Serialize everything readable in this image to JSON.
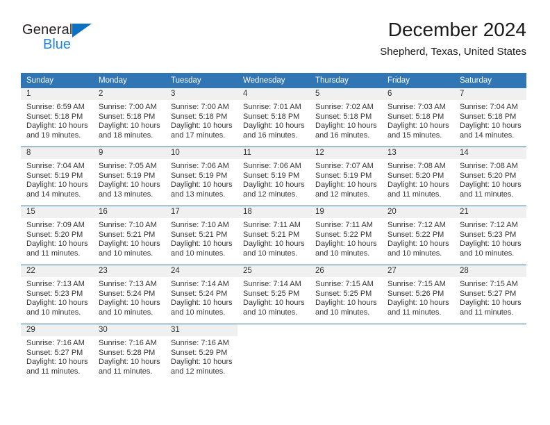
{
  "brand": {
    "name_part1": "General",
    "name_part2": "Blue",
    "triangle_icon": "triangle-icon",
    "accent_blue": "#0a71c5",
    "light_blue": "#1b87dd"
  },
  "header": {
    "title": "December 2024",
    "subtitle": "Shepherd, Texas, United States"
  },
  "theme": {
    "header_bg": "#3075b4",
    "daynum_bg": "#f0f0f0",
    "row_divider": "#3075b4",
    "text": "#333333"
  },
  "weekday_headers": [
    "Sunday",
    "Monday",
    "Tuesday",
    "Wednesday",
    "Thursday",
    "Friday",
    "Saturday"
  ],
  "weeks": [
    [
      {
        "day": "1",
        "sunrise": "Sunrise: 6:59 AM",
        "sunset": "Sunset: 5:18 PM",
        "daylight": "Daylight: 10 hours and 19 minutes."
      },
      {
        "day": "2",
        "sunrise": "Sunrise: 7:00 AM",
        "sunset": "Sunset: 5:18 PM",
        "daylight": "Daylight: 10 hours and 18 minutes."
      },
      {
        "day": "3",
        "sunrise": "Sunrise: 7:00 AM",
        "sunset": "Sunset: 5:18 PM",
        "daylight": "Daylight: 10 hours and 17 minutes."
      },
      {
        "day": "4",
        "sunrise": "Sunrise: 7:01 AM",
        "sunset": "Sunset: 5:18 PM",
        "daylight": "Daylight: 10 hours and 16 minutes."
      },
      {
        "day": "5",
        "sunrise": "Sunrise: 7:02 AM",
        "sunset": "Sunset: 5:18 PM",
        "daylight": "Daylight: 10 hours and 16 minutes."
      },
      {
        "day": "6",
        "sunrise": "Sunrise: 7:03 AM",
        "sunset": "Sunset: 5:18 PM",
        "daylight": "Daylight: 10 hours and 15 minutes."
      },
      {
        "day": "7",
        "sunrise": "Sunrise: 7:04 AM",
        "sunset": "Sunset: 5:18 PM",
        "daylight": "Daylight: 10 hours and 14 minutes."
      }
    ],
    [
      {
        "day": "8",
        "sunrise": "Sunrise: 7:04 AM",
        "sunset": "Sunset: 5:19 PM",
        "daylight": "Daylight: 10 hours and 14 minutes."
      },
      {
        "day": "9",
        "sunrise": "Sunrise: 7:05 AM",
        "sunset": "Sunset: 5:19 PM",
        "daylight": "Daylight: 10 hours and 13 minutes."
      },
      {
        "day": "10",
        "sunrise": "Sunrise: 7:06 AM",
        "sunset": "Sunset: 5:19 PM",
        "daylight": "Daylight: 10 hours and 13 minutes."
      },
      {
        "day": "11",
        "sunrise": "Sunrise: 7:06 AM",
        "sunset": "Sunset: 5:19 PM",
        "daylight": "Daylight: 10 hours and 12 minutes."
      },
      {
        "day": "12",
        "sunrise": "Sunrise: 7:07 AM",
        "sunset": "Sunset: 5:19 PM",
        "daylight": "Daylight: 10 hours and 12 minutes."
      },
      {
        "day": "13",
        "sunrise": "Sunrise: 7:08 AM",
        "sunset": "Sunset: 5:20 PM",
        "daylight": "Daylight: 10 hours and 11 minutes."
      },
      {
        "day": "14",
        "sunrise": "Sunrise: 7:08 AM",
        "sunset": "Sunset: 5:20 PM",
        "daylight": "Daylight: 10 hours and 11 minutes."
      }
    ],
    [
      {
        "day": "15",
        "sunrise": "Sunrise: 7:09 AM",
        "sunset": "Sunset: 5:20 PM",
        "daylight": "Daylight: 10 hours and 11 minutes."
      },
      {
        "day": "16",
        "sunrise": "Sunrise: 7:10 AM",
        "sunset": "Sunset: 5:21 PM",
        "daylight": "Daylight: 10 hours and 10 minutes."
      },
      {
        "day": "17",
        "sunrise": "Sunrise: 7:10 AM",
        "sunset": "Sunset: 5:21 PM",
        "daylight": "Daylight: 10 hours and 10 minutes."
      },
      {
        "day": "18",
        "sunrise": "Sunrise: 7:11 AM",
        "sunset": "Sunset: 5:21 PM",
        "daylight": "Daylight: 10 hours and 10 minutes."
      },
      {
        "day": "19",
        "sunrise": "Sunrise: 7:11 AM",
        "sunset": "Sunset: 5:22 PM",
        "daylight": "Daylight: 10 hours and 10 minutes."
      },
      {
        "day": "20",
        "sunrise": "Sunrise: 7:12 AM",
        "sunset": "Sunset: 5:22 PM",
        "daylight": "Daylight: 10 hours and 10 minutes."
      },
      {
        "day": "21",
        "sunrise": "Sunrise: 7:12 AM",
        "sunset": "Sunset: 5:23 PM",
        "daylight": "Daylight: 10 hours and 10 minutes."
      }
    ],
    [
      {
        "day": "22",
        "sunrise": "Sunrise: 7:13 AM",
        "sunset": "Sunset: 5:23 PM",
        "daylight": "Daylight: 10 hours and 10 minutes."
      },
      {
        "day": "23",
        "sunrise": "Sunrise: 7:13 AM",
        "sunset": "Sunset: 5:24 PM",
        "daylight": "Daylight: 10 hours and 10 minutes."
      },
      {
        "day": "24",
        "sunrise": "Sunrise: 7:14 AM",
        "sunset": "Sunset: 5:24 PM",
        "daylight": "Daylight: 10 hours and 10 minutes."
      },
      {
        "day": "25",
        "sunrise": "Sunrise: 7:14 AM",
        "sunset": "Sunset: 5:25 PM",
        "daylight": "Daylight: 10 hours and 10 minutes."
      },
      {
        "day": "26",
        "sunrise": "Sunrise: 7:15 AM",
        "sunset": "Sunset: 5:25 PM",
        "daylight": "Daylight: 10 hours and 10 minutes."
      },
      {
        "day": "27",
        "sunrise": "Sunrise: 7:15 AM",
        "sunset": "Sunset: 5:26 PM",
        "daylight": "Daylight: 10 hours and 11 minutes."
      },
      {
        "day": "28",
        "sunrise": "Sunrise: 7:15 AM",
        "sunset": "Sunset: 5:27 PM",
        "daylight": "Daylight: 10 hours and 11 minutes."
      }
    ],
    [
      {
        "day": "29",
        "sunrise": "Sunrise: 7:16 AM",
        "sunset": "Sunset: 5:27 PM",
        "daylight": "Daylight: 10 hours and 11 minutes."
      },
      {
        "day": "30",
        "sunrise": "Sunrise: 7:16 AM",
        "sunset": "Sunset: 5:28 PM",
        "daylight": "Daylight: 10 hours and 11 minutes."
      },
      {
        "day": "31",
        "sunrise": "Sunrise: 7:16 AM",
        "sunset": "Sunset: 5:29 PM",
        "daylight": "Daylight: 10 hours and 12 minutes."
      },
      {
        "day": "",
        "sunrise": "",
        "sunset": "",
        "daylight": ""
      },
      {
        "day": "",
        "sunrise": "",
        "sunset": "",
        "daylight": ""
      },
      {
        "day": "",
        "sunrise": "",
        "sunset": "",
        "daylight": ""
      },
      {
        "day": "",
        "sunrise": "",
        "sunset": "",
        "daylight": ""
      }
    ]
  ]
}
